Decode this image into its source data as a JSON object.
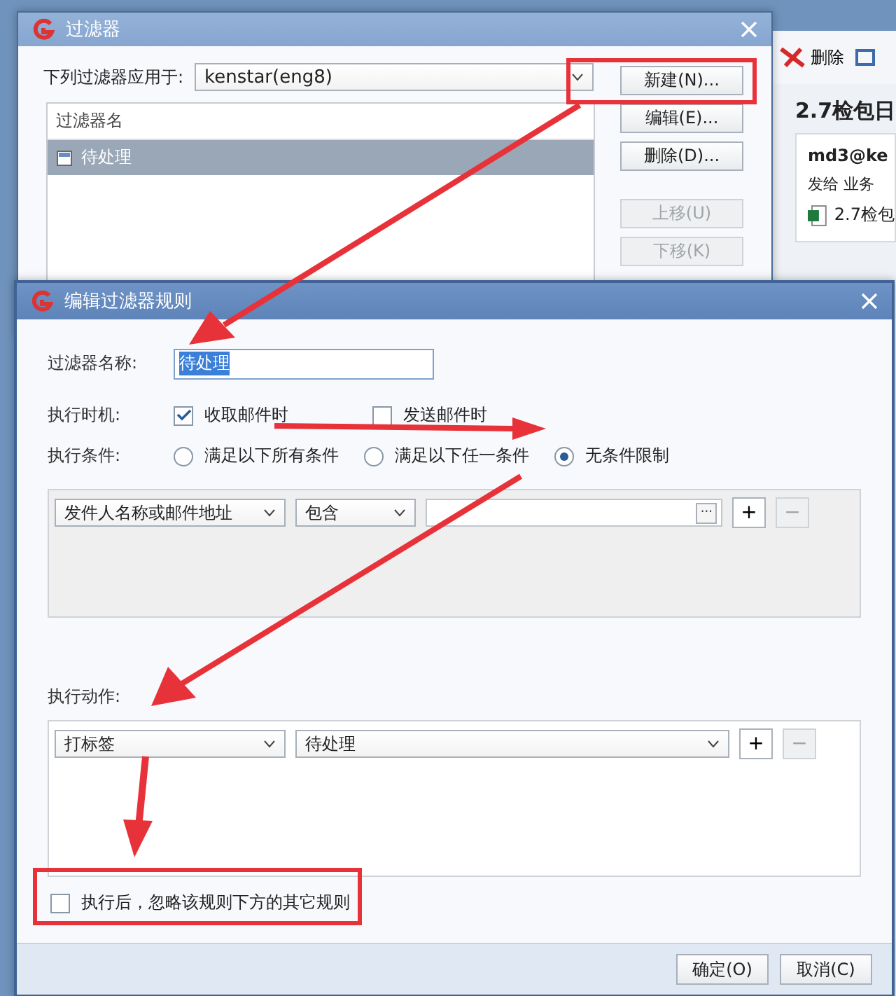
{
  "background_app": {
    "toolbar": [
      {
        "label": "删除"
      }
    ],
    "heading": "2.7检包日",
    "message": {
      "sender": "md3@ke",
      "recipient": "发给 业务",
      "attachment": "2.7检包"
    }
  },
  "filters_window": {
    "title": "过滤器",
    "apply_label": "下列过滤器应用于:",
    "account": "kenstar(eng8)",
    "list_header": "过滤器名",
    "filters": [
      {
        "name": "待处理",
        "selected": true
      }
    ],
    "buttons": [
      {
        "label": "新建(N)...",
        "disabled": false
      },
      {
        "label": "编辑(E)...",
        "disabled": false
      },
      {
        "label": "删除(D)...",
        "disabled": false
      },
      {
        "label": "上移(U)",
        "disabled": true
      },
      {
        "label": "下移(K)",
        "disabled": true
      }
    ]
  },
  "rule_window": {
    "title": "编辑过滤器规则",
    "name_label": "过滤器名称:",
    "name_value": "待处理",
    "timing_label": "执行时机:",
    "timing": [
      {
        "label": "收取邮件时",
        "checked": true
      },
      {
        "label": "发送邮件时",
        "checked": false
      }
    ],
    "condition_label": "执行条件:",
    "conditions": [
      {
        "label": "满足以下所有条件",
        "selected": false
      },
      {
        "label": "满足以下任一条件",
        "selected": false
      },
      {
        "label": "无条件限制",
        "selected": true
      }
    ],
    "condition_row": {
      "field": "发件人名称或邮件地址",
      "operator": "包含",
      "browse": "···",
      "add": "+",
      "remove": "−"
    },
    "action_label": "执行动作:",
    "action_row": {
      "action": "打标签",
      "value": "待处理",
      "add": "+",
      "remove": "−"
    },
    "stop_rule": {
      "label": "执行后，忽略该规则下方的其它规则",
      "checked": false
    },
    "buttons": [
      "确定(O)",
      "取消(C)"
    ]
  }
}
